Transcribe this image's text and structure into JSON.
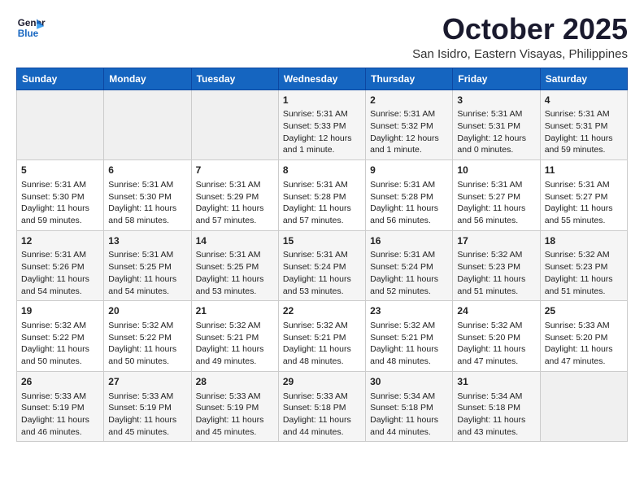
{
  "header": {
    "logo_general": "General",
    "logo_blue": "Blue",
    "month_title": "October 2025",
    "location": "San Isidro, Eastern Visayas, Philippines"
  },
  "weekdays": [
    "Sunday",
    "Monday",
    "Tuesday",
    "Wednesday",
    "Thursday",
    "Friday",
    "Saturday"
  ],
  "weeks": [
    [
      {
        "day": null,
        "info": null
      },
      {
        "day": null,
        "info": null
      },
      {
        "day": null,
        "info": null
      },
      {
        "day": "1",
        "sunrise": "Sunrise: 5:31 AM",
        "sunset": "Sunset: 5:33 PM",
        "daylight": "Daylight: 12 hours and 1 minute."
      },
      {
        "day": "2",
        "sunrise": "Sunrise: 5:31 AM",
        "sunset": "Sunset: 5:32 PM",
        "daylight": "Daylight: 12 hours and 1 minute."
      },
      {
        "day": "3",
        "sunrise": "Sunrise: 5:31 AM",
        "sunset": "Sunset: 5:31 PM",
        "daylight": "Daylight: 12 hours and 0 minutes."
      },
      {
        "day": "4",
        "sunrise": "Sunrise: 5:31 AM",
        "sunset": "Sunset: 5:31 PM",
        "daylight": "Daylight: 11 hours and 59 minutes."
      }
    ],
    [
      {
        "day": "5",
        "sunrise": "Sunrise: 5:31 AM",
        "sunset": "Sunset: 5:30 PM",
        "daylight": "Daylight: 11 hours and 59 minutes."
      },
      {
        "day": "6",
        "sunrise": "Sunrise: 5:31 AM",
        "sunset": "Sunset: 5:30 PM",
        "daylight": "Daylight: 11 hours and 58 minutes."
      },
      {
        "day": "7",
        "sunrise": "Sunrise: 5:31 AM",
        "sunset": "Sunset: 5:29 PM",
        "daylight": "Daylight: 11 hours and 57 minutes."
      },
      {
        "day": "8",
        "sunrise": "Sunrise: 5:31 AM",
        "sunset": "Sunset: 5:28 PM",
        "daylight": "Daylight: 11 hours and 57 minutes."
      },
      {
        "day": "9",
        "sunrise": "Sunrise: 5:31 AM",
        "sunset": "Sunset: 5:28 PM",
        "daylight": "Daylight: 11 hours and 56 minutes."
      },
      {
        "day": "10",
        "sunrise": "Sunrise: 5:31 AM",
        "sunset": "Sunset: 5:27 PM",
        "daylight": "Daylight: 11 hours and 56 minutes."
      },
      {
        "day": "11",
        "sunrise": "Sunrise: 5:31 AM",
        "sunset": "Sunset: 5:27 PM",
        "daylight": "Daylight: 11 hours and 55 minutes."
      }
    ],
    [
      {
        "day": "12",
        "sunrise": "Sunrise: 5:31 AM",
        "sunset": "Sunset: 5:26 PM",
        "daylight": "Daylight: 11 hours and 54 minutes."
      },
      {
        "day": "13",
        "sunrise": "Sunrise: 5:31 AM",
        "sunset": "Sunset: 5:25 PM",
        "daylight": "Daylight: 11 hours and 54 minutes."
      },
      {
        "day": "14",
        "sunrise": "Sunrise: 5:31 AM",
        "sunset": "Sunset: 5:25 PM",
        "daylight": "Daylight: 11 hours and 53 minutes."
      },
      {
        "day": "15",
        "sunrise": "Sunrise: 5:31 AM",
        "sunset": "Sunset: 5:24 PM",
        "daylight": "Daylight: 11 hours and 53 minutes."
      },
      {
        "day": "16",
        "sunrise": "Sunrise: 5:31 AM",
        "sunset": "Sunset: 5:24 PM",
        "daylight": "Daylight: 11 hours and 52 minutes."
      },
      {
        "day": "17",
        "sunrise": "Sunrise: 5:32 AM",
        "sunset": "Sunset: 5:23 PM",
        "daylight": "Daylight: 11 hours and 51 minutes."
      },
      {
        "day": "18",
        "sunrise": "Sunrise: 5:32 AM",
        "sunset": "Sunset: 5:23 PM",
        "daylight": "Daylight: 11 hours and 51 minutes."
      }
    ],
    [
      {
        "day": "19",
        "sunrise": "Sunrise: 5:32 AM",
        "sunset": "Sunset: 5:22 PM",
        "daylight": "Daylight: 11 hours and 50 minutes."
      },
      {
        "day": "20",
        "sunrise": "Sunrise: 5:32 AM",
        "sunset": "Sunset: 5:22 PM",
        "daylight": "Daylight: 11 hours and 50 minutes."
      },
      {
        "day": "21",
        "sunrise": "Sunrise: 5:32 AM",
        "sunset": "Sunset: 5:21 PM",
        "daylight": "Daylight: 11 hours and 49 minutes."
      },
      {
        "day": "22",
        "sunrise": "Sunrise: 5:32 AM",
        "sunset": "Sunset: 5:21 PM",
        "daylight": "Daylight: 11 hours and 48 minutes."
      },
      {
        "day": "23",
        "sunrise": "Sunrise: 5:32 AM",
        "sunset": "Sunset: 5:21 PM",
        "daylight": "Daylight: 11 hours and 48 minutes."
      },
      {
        "day": "24",
        "sunrise": "Sunrise: 5:32 AM",
        "sunset": "Sunset: 5:20 PM",
        "daylight": "Daylight: 11 hours and 47 minutes."
      },
      {
        "day": "25",
        "sunrise": "Sunrise: 5:33 AM",
        "sunset": "Sunset: 5:20 PM",
        "daylight": "Daylight: 11 hours and 47 minutes."
      }
    ],
    [
      {
        "day": "26",
        "sunrise": "Sunrise: 5:33 AM",
        "sunset": "Sunset: 5:19 PM",
        "daylight": "Daylight: 11 hours and 46 minutes."
      },
      {
        "day": "27",
        "sunrise": "Sunrise: 5:33 AM",
        "sunset": "Sunset: 5:19 PM",
        "daylight": "Daylight: 11 hours and 45 minutes."
      },
      {
        "day": "28",
        "sunrise": "Sunrise: 5:33 AM",
        "sunset": "Sunset: 5:19 PM",
        "daylight": "Daylight: 11 hours and 45 minutes."
      },
      {
        "day": "29",
        "sunrise": "Sunrise: 5:33 AM",
        "sunset": "Sunset: 5:18 PM",
        "daylight": "Daylight: 11 hours and 44 minutes."
      },
      {
        "day": "30",
        "sunrise": "Sunrise: 5:34 AM",
        "sunset": "Sunset: 5:18 PM",
        "daylight": "Daylight: 11 hours and 44 minutes."
      },
      {
        "day": "31",
        "sunrise": "Sunrise: 5:34 AM",
        "sunset": "Sunset: 5:18 PM",
        "daylight": "Daylight: 11 hours and 43 minutes."
      },
      {
        "day": null,
        "info": null
      }
    ]
  ]
}
